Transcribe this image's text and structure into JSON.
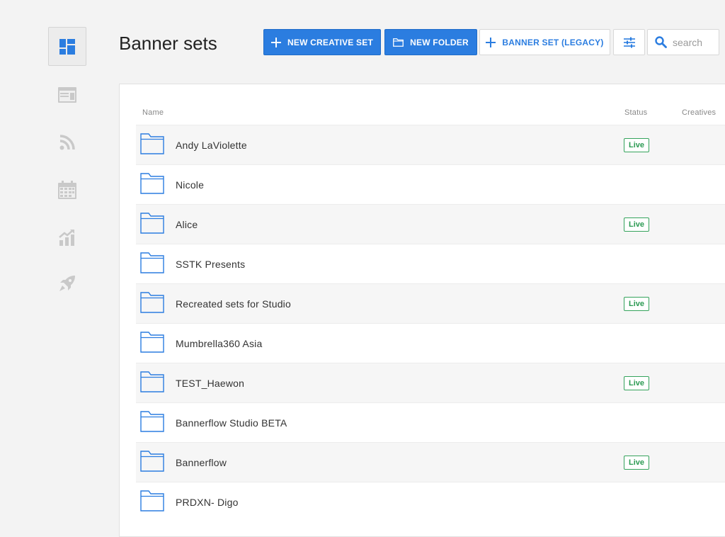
{
  "page": {
    "title": "Banner sets"
  },
  "sidebar": {
    "items": [
      {
        "icon": "dashboard-icon",
        "active": true
      },
      {
        "icon": "layout-icon",
        "active": false
      },
      {
        "icon": "rss-feed-icon",
        "active": false
      },
      {
        "icon": "calendar-icon",
        "active": false
      },
      {
        "icon": "analytics-icon",
        "active": false
      },
      {
        "icon": "rocket-icon",
        "active": false
      }
    ]
  },
  "toolbar": {
    "new_creative_set": "NEW CREATIVE SET",
    "new_folder": "NEW FOLDER",
    "banner_set_legacy": "BANNER SET (LEGACY)",
    "filter_icon": "sliders-icon",
    "search_placeholder": "search"
  },
  "colors": {
    "accent": "#2b7de0",
    "live": "#2b9a52"
  },
  "table": {
    "columns": {
      "name": "Name",
      "status": "Status",
      "creatives": "Creatives"
    },
    "rows": [
      {
        "name": "Andy LaViolette",
        "status": "Live"
      },
      {
        "name": "Nicole",
        "status": ""
      },
      {
        "name": "Alice",
        "status": "Live"
      },
      {
        "name": "SSTK Presents",
        "status": ""
      },
      {
        "name": "Recreated sets for Studio",
        "status": "Live"
      },
      {
        "name": "Mumbrella360 Asia",
        "status": ""
      },
      {
        "name": "TEST_Haewon",
        "status": "Live"
      },
      {
        "name": "Bannerflow Studio BETA",
        "status": ""
      },
      {
        "name": "Bannerflow",
        "status": "Live"
      },
      {
        "name": "PRDXN- Digo",
        "status": ""
      }
    ]
  }
}
